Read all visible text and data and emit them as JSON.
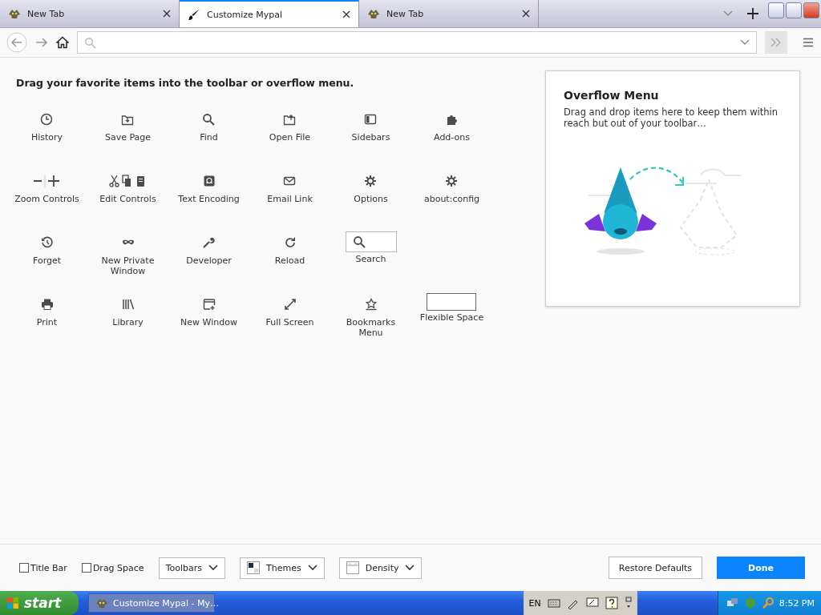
{
  "tabs": [
    {
      "label": "New Tab",
      "kind": "mascot",
      "selected": false
    },
    {
      "label": "Customize Mypal",
      "kind": "brush",
      "selected": true
    },
    {
      "label": "New Tab",
      "kind": "mascot",
      "selected": false
    }
  ],
  "heading": "Drag your favorite items into the toolbar or overflow menu.",
  "palette": [
    {
      "label": "History",
      "kind": "history"
    },
    {
      "label": "Save Page",
      "kind": "save"
    },
    {
      "label": "Find",
      "kind": "find"
    },
    {
      "label": "Open File",
      "kind": "open"
    },
    {
      "label": "Sidebars",
      "kind": "sidebar"
    },
    {
      "label": "Add-ons",
      "kind": "addons"
    },
    {
      "label": "Zoom Controls",
      "kind": "zoom"
    },
    {
      "label": "Edit Controls",
      "kind": "edit"
    },
    {
      "label": "Text Encoding",
      "kind": "encoding"
    },
    {
      "label": "Email Link",
      "kind": "email"
    },
    {
      "label": "Options",
      "kind": "gear"
    },
    {
      "label": "about:config",
      "kind": "gear"
    },
    {
      "label": "Forget",
      "kind": "forget"
    },
    {
      "label": "New Private Window",
      "kind": "private"
    },
    {
      "label": "Developer",
      "kind": "wrench"
    },
    {
      "label": "Reload",
      "kind": "reload"
    },
    {
      "label": "Search",
      "kind": "search"
    },
    {
      "kind": "empty"
    },
    {
      "label": "Print",
      "kind": "print"
    },
    {
      "label": "Library",
      "kind": "library"
    },
    {
      "label": "New Window",
      "kind": "newwindow"
    },
    {
      "label": "Full Screen",
      "kind": "fullscreen"
    },
    {
      "label": "Bookmarks Menu",
      "kind": "bookmarks"
    },
    {
      "label": "Flexible Space",
      "kind": "flex"
    }
  ],
  "overflow": {
    "title": "Overflow Menu",
    "text": "Drag and drop items here to keep them within reach but out of your toolbar…"
  },
  "checkboxes": [
    {
      "label": "Title Bar",
      "checked": false
    },
    {
      "label": "Drag Space",
      "checked": false
    }
  ],
  "dropdowns": [
    {
      "label": "Toolbars",
      "kind": "plain"
    },
    {
      "label": "Themes",
      "kind": "themes"
    },
    {
      "label": "Density",
      "kind": "density"
    }
  ],
  "buttons": [
    {
      "label": "Restore Defaults",
      "kind": "secondary"
    },
    {
      "label": "Done",
      "kind": "primary"
    }
  ],
  "taskbar": {
    "start": "start",
    "task": "Customize Mypal - My…",
    "language": "EN",
    "clock": "8:52 PM"
  }
}
